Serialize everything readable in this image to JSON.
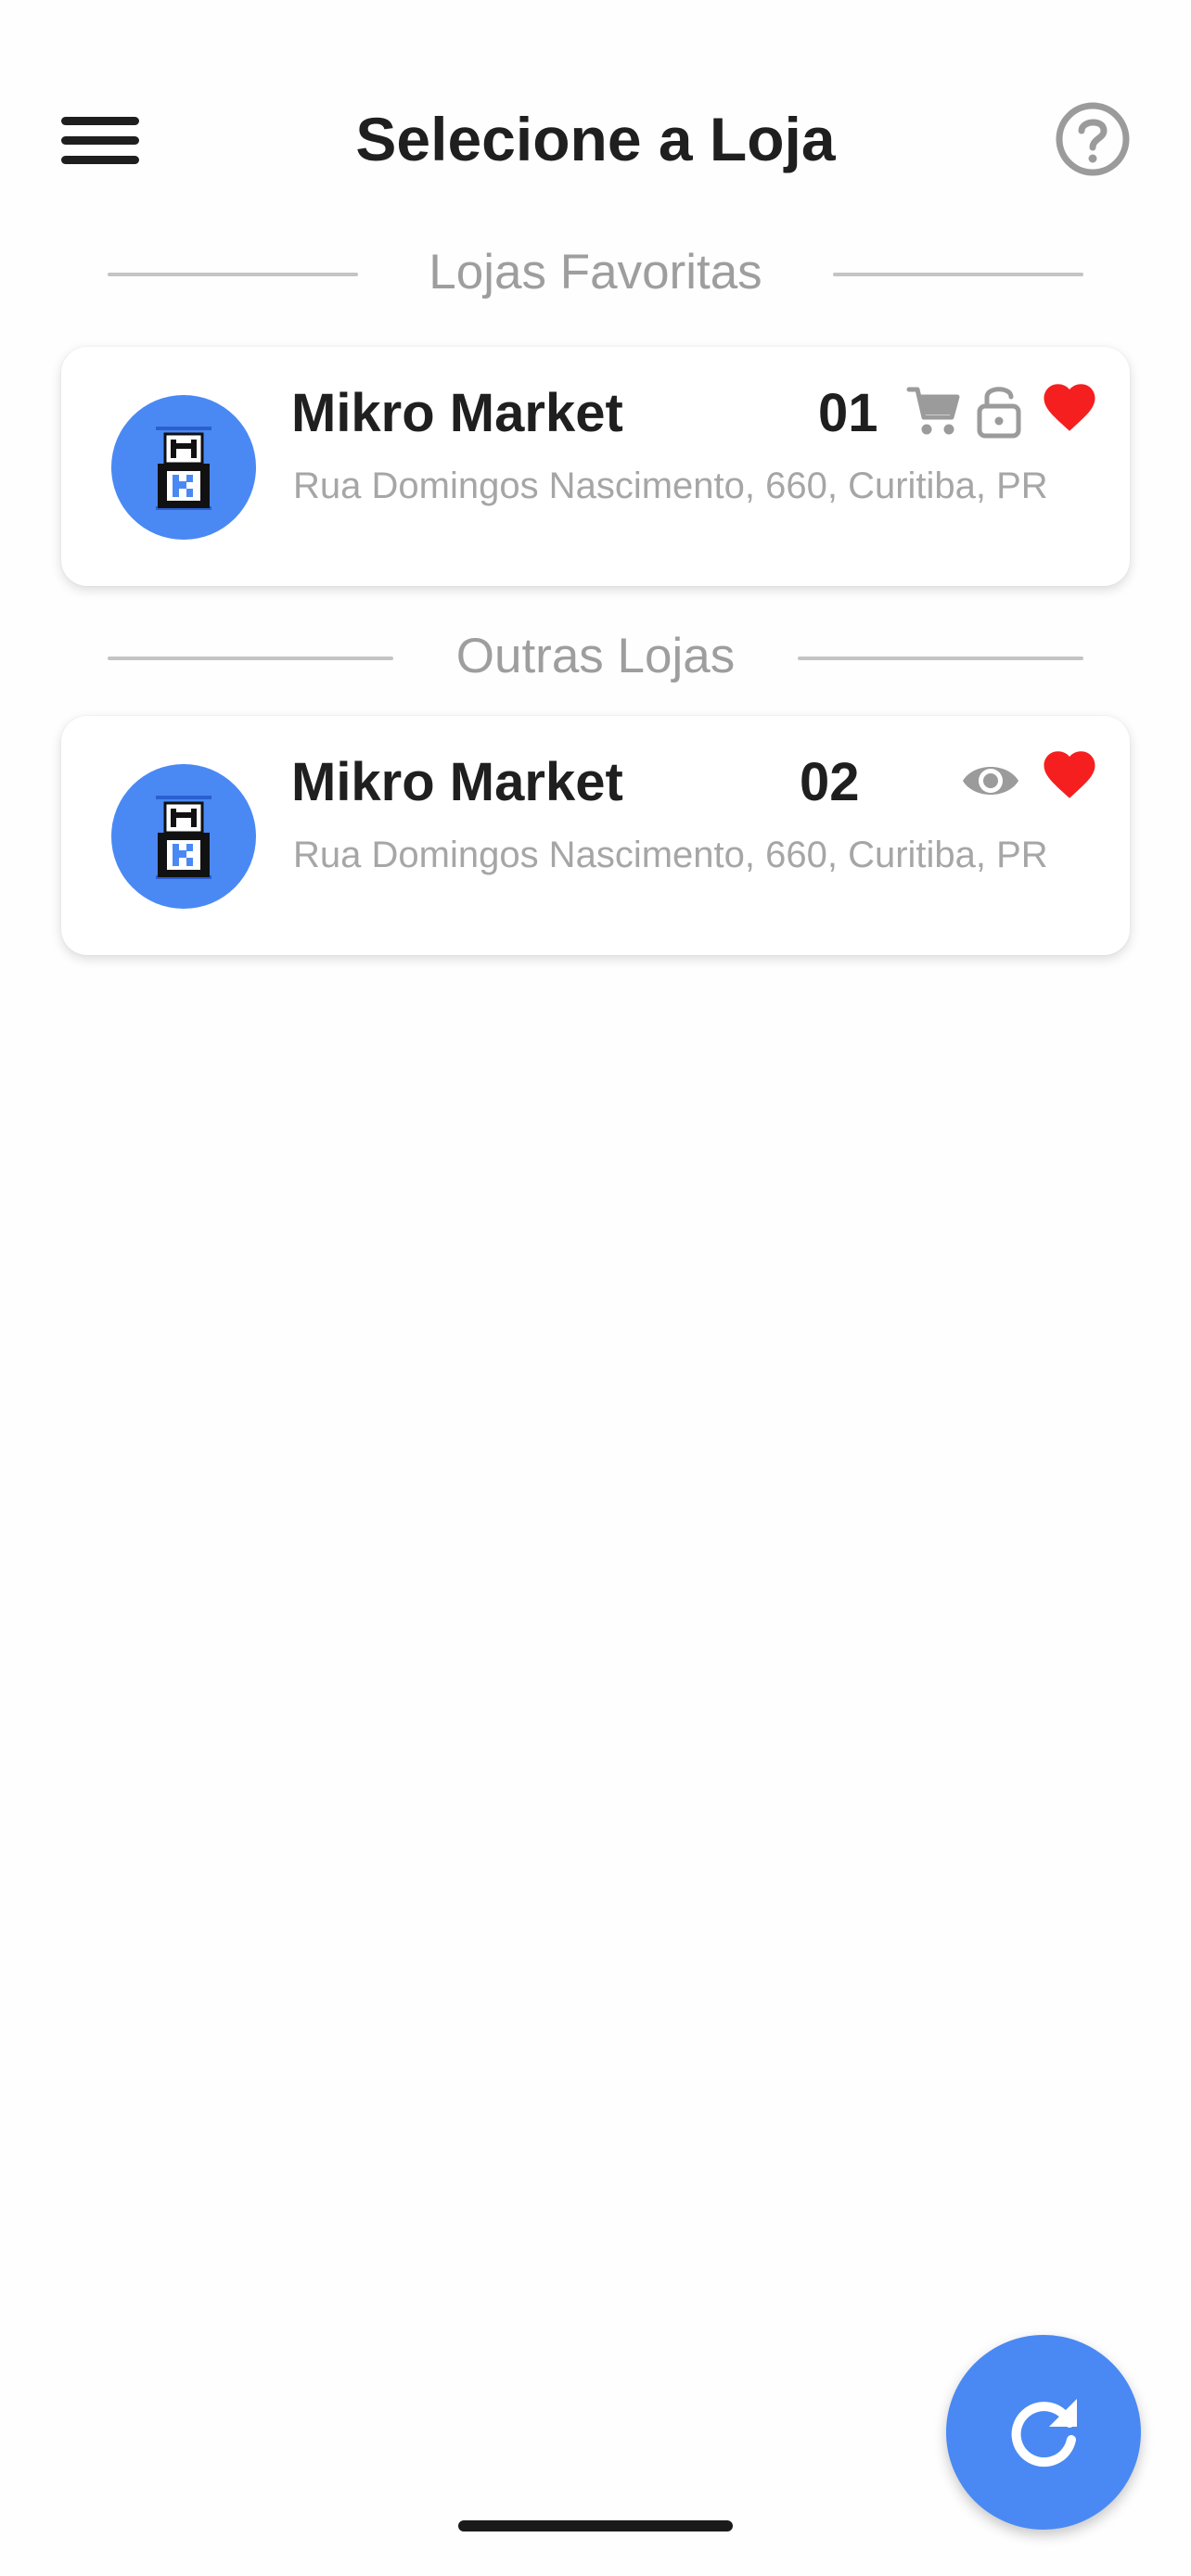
{
  "header": {
    "title": "Selecione a Loja",
    "menu_icon": "hamburger-menu-icon",
    "help_icon": "help-circle-icon"
  },
  "sections": {
    "favorites_label": "Lojas Favoritas",
    "others_label": "Outras Lojas"
  },
  "stores": {
    "favorite": {
      "name": "Mikro Market",
      "number": "01",
      "address": "Rua Domingos Nascimento, 660, Curitiba, PR",
      "icons": [
        "cart-icon",
        "lock-open-icon",
        "heart-icon"
      ]
    },
    "other": {
      "name": "Mikro Market",
      "number": "02",
      "address": "Rua Domingos Nascimento, 660, Curitiba, PR",
      "icons": [
        "eye-icon",
        "heart-icon"
      ]
    }
  },
  "fab": {
    "icon": "refresh-icon"
  },
  "colors": {
    "accent": "#4a89f3",
    "heart": "#f51f1f",
    "muted_icon": "#9b9b9b",
    "text": "#1f1f1f",
    "secondary_text": "#a6a6a6",
    "divider": "#c4c4c4"
  }
}
